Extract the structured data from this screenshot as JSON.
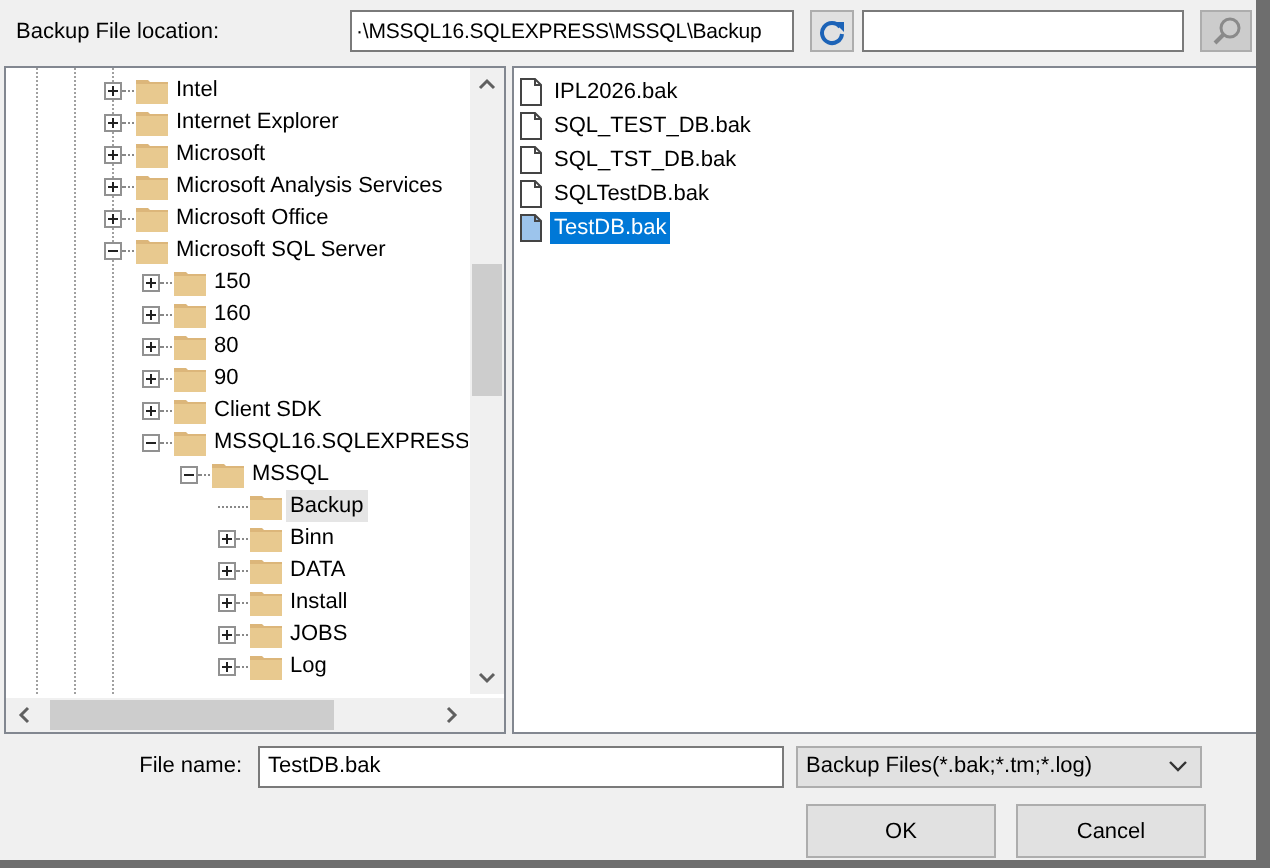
{
  "location": {
    "label": "Backup File location:",
    "path": "·\\MSSQL16.SQLEXPRESS\\MSSQL\\Backup"
  },
  "tree": {
    "items": [
      {
        "label": "Intel",
        "kind": "expandable",
        "expanded": false,
        "selected": false
      },
      {
        "label": "Internet Explorer",
        "kind": "expandable",
        "expanded": false,
        "selected": false
      },
      {
        "label": "Microsoft",
        "kind": "expandable",
        "expanded": false,
        "selected": false
      },
      {
        "label": "Microsoft Analysis Services",
        "kind": "expandable",
        "expanded": false,
        "selected": false
      },
      {
        "label": "Microsoft Office",
        "kind": "expandable",
        "expanded": false,
        "selected": false
      },
      {
        "label": "Microsoft SQL Server",
        "kind": "expandable",
        "expanded": true,
        "selected": false,
        "children": [
          {
            "label": "150",
            "kind": "expandable",
            "expanded": false,
            "selected": false
          },
          {
            "label": "160",
            "kind": "expandable",
            "expanded": false,
            "selected": false
          },
          {
            "label": "80",
            "kind": "expandable",
            "expanded": false,
            "selected": false
          },
          {
            "label": "90",
            "kind": "expandable",
            "expanded": false,
            "selected": false
          },
          {
            "label": "Client SDK",
            "kind": "expandable",
            "expanded": false,
            "selected": false
          },
          {
            "label": "MSSQL16.SQLEXPRESS",
            "kind": "expandable",
            "expanded": true,
            "selected": false,
            "children": [
              {
                "label": "MSSQL",
                "kind": "expandable",
                "expanded": true,
                "selected": false,
                "children": [
                  {
                    "label": "Backup",
                    "kind": "leaf",
                    "selected": true
                  },
                  {
                    "label": "Binn",
                    "kind": "expandable",
                    "expanded": false,
                    "selected": false
                  },
                  {
                    "label": "DATA",
                    "kind": "expandable",
                    "expanded": false,
                    "selected": false
                  },
                  {
                    "label": "Install",
                    "kind": "expandable",
                    "expanded": false,
                    "selected": false
                  },
                  {
                    "label": "JOBS",
                    "kind": "expandable",
                    "expanded": false,
                    "selected": false
                  },
                  {
                    "label": "Log",
                    "kind": "expandable",
                    "expanded": false,
                    "selected": false
                  }
                ]
              }
            ]
          }
        ]
      }
    ]
  },
  "files": [
    {
      "name": "IPL2026.bak",
      "selected": false
    },
    {
      "name": "SQL_TEST_DB.bak",
      "selected": false
    },
    {
      "name": "SQL_TST_DB.bak",
      "selected": false
    },
    {
      "name": "SQLTestDB.bak",
      "selected": false
    },
    {
      "name": "TestDB.bak",
      "selected": true
    }
  ],
  "file_name": {
    "label": "File name:",
    "value": "TestDB.bak"
  },
  "file_type": {
    "value": "Backup Files(*.bak;*.tm;*.log)"
  },
  "buttons": [
    {
      "label": "OK"
    },
    {
      "label": "Cancel"
    }
  ]
}
